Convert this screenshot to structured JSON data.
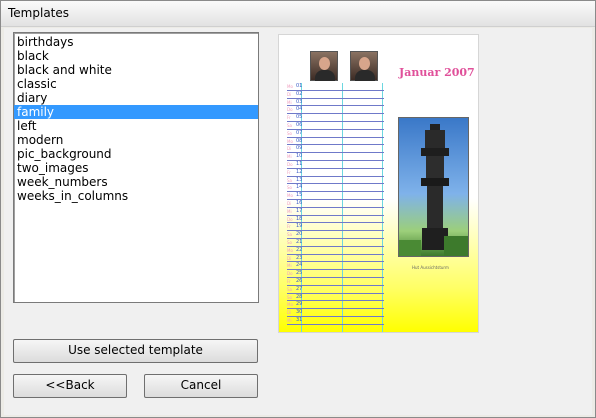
{
  "window": {
    "title": "Templates"
  },
  "templates": {
    "items": [
      "birthdays",
      "black",
      "black and white",
      "classic",
      "diary",
      "family",
      "left",
      "modern",
      "pic_background",
      "two_images",
      "week_numbers",
      "weeks_in_columns"
    ],
    "selected_index": 5,
    "selected": "family"
  },
  "buttons": {
    "use_selected": "Use selected template",
    "back": "<<Back",
    "cancel": "Cancel"
  },
  "preview": {
    "month_title": "Januar 2007",
    "caption": "Hut Aussichtsturm",
    "days": [
      {
        "d": "01",
        "n": "Mo"
      },
      {
        "d": "02",
        "n": "Di"
      },
      {
        "d": "03",
        "n": "Mi"
      },
      {
        "d": "04",
        "n": "Do"
      },
      {
        "d": "05",
        "n": "Fr"
      },
      {
        "d": "06",
        "n": "Sa"
      },
      {
        "d": "07",
        "n": "So"
      },
      {
        "d": "08",
        "n": "Mo"
      },
      {
        "d": "09",
        "n": "Di"
      },
      {
        "d": "10",
        "n": "Mi"
      },
      {
        "d": "11",
        "n": "Do"
      },
      {
        "d": "12",
        "n": "Fr"
      },
      {
        "d": "13",
        "n": "Sa"
      },
      {
        "d": "14",
        "n": "So"
      },
      {
        "d": "15",
        "n": "Mo"
      },
      {
        "d": "16",
        "n": "Di"
      },
      {
        "d": "17",
        "n": "Mi"
      },
      {
        "d": "18",
        "n": "Do"
      },
      {
        "d": "19",
        "n": "Fr"
      },
      {
        "d": "20",
        "n": "Sa"
      },
      {
        "d": "21",
        "n": "So"
      },
      {
        "d": "22",
        "n": "Mo"
      },
      {
        "d": "23",
        "n": "Di"
      },
      {
        "d": "24",
        "n": "Mi"
      },
      {
        "d": "25",
        "n": "Do"
      },
      {
        "d": "26",
        "n": "Fr"
      },
      {
        "d": "27",
        "n": "Sa"
      },
      {
        "d": "28",
        "n": "So"
      },
      {
        "d": "29",
        "n": "Mo"
      },
      {
        "d": "30",
        "n": "Di"
      },
      {
        "d": "31",
        "n": "Mi"
      }
    ]
  }
}
